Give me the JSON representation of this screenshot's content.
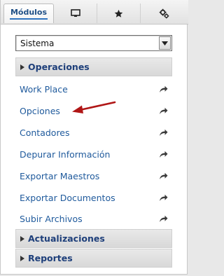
{
  "tabs": [
    {
      "label": "Módulos",
      "icon": null,
      "active": true
    },
    {
      "label": "",
      "icon": "monitor-icon",
      "active": false
    },
    {
      "label": "",
      "icon": "star-icon",
      "active": false
    },
    {
      "label": "",
      "icon": "gears-icon",
      "active": false
    }
  ],
  "select": {
    "value": "Sistema"
  },
  "sections": {
    "operaciones": "Operaciones",
    "actualizaciones": "Actualizaciones",
    "reportes": "Reportes"
  },
  "operaciones_items": [
    {
      "label": "Work Place",
      "icon": "share-arrow-icon"
    },
    {
      "label": "Opciones",
      "icon": "share-arrow-icon"
    },
    {
      "label": "Contadores",
      "icon": "share-arrow-icon"
    },
    {
      "label": "Depurar Información",
      "icon": "share-arrow-icon"
    },
    {
      "label": "Exportar Maestros",
      "icon": "share-arrow-icon"
    },
    {
      "label": "Exportar Documentos",
      "icon": "share-arrow-icon"
    },
    {
      "label": "Subir Archivos",
      "icon": "share-arrow-icon"
    }
  ],
  "colors": {
    "link": "#1f5a9c",
    "header_text": "#1e3f7a",
    "annotation_arrow": "#b01616"
  }
}
